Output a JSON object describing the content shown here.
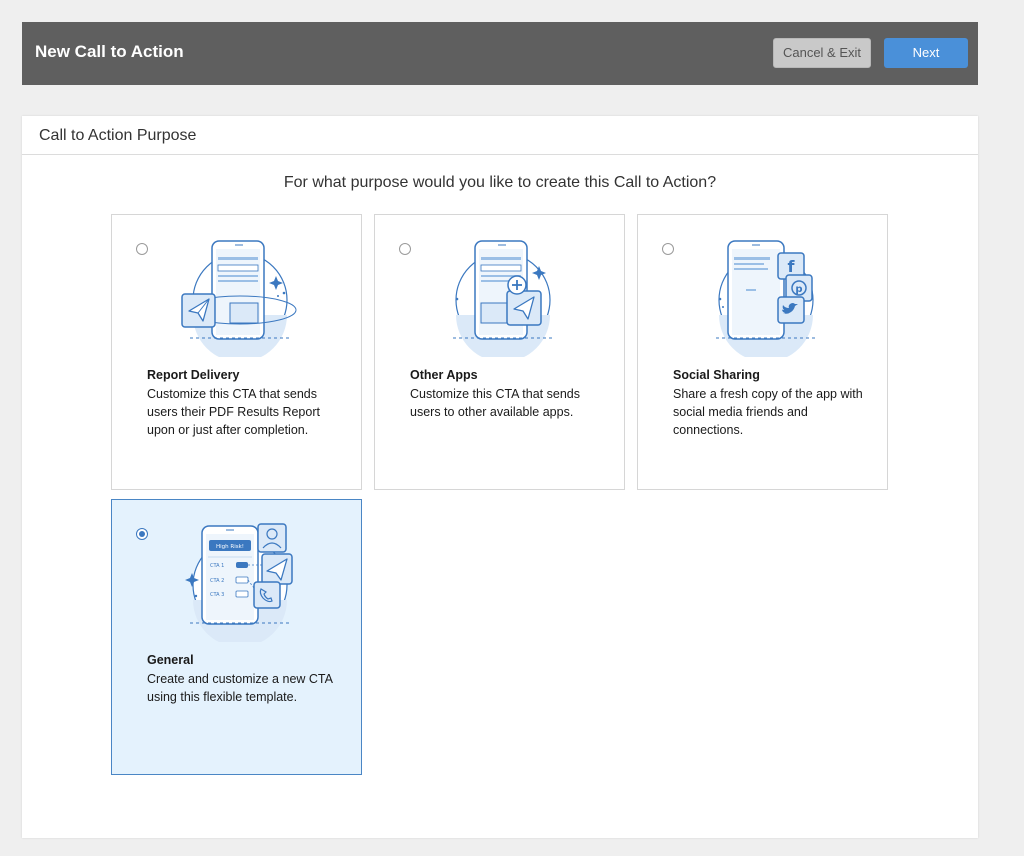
{
  "header": {
    "title": "New Call to Action",
    "cancel_label": "Cancel & Exit",
    "next_label": "Next"
  },
  "panel": {
    "title": "Call to Action Purpose",
    "question": "For what purpose would you like to create this Call to Action?"
  },
  "options": [
    {
      "name": "Report Delivery",
      "description": "Customize this CTA that sends users their PDF Results Report upon or just after completion.",
      "selected": false,
      "icon": "paper-plane-phone-illustration"
    },
    {
      "name": "Other Apps",
      "description": "Customize this CTA that sends users to other available apps.",
      "selected": false,
      "icon": "phone-plus-send-illustration"
    },
    {
      "name": "Social Sharing",
      "description": "Share a fresh copy of the app with social media friends and connections.",
      "selected": false,
      "icon": "phone-social-icons-illustration"
    },
    {
      "name": "General",
      "description": "Create and customize a new CTA using this flexible template.",
      "selected": true,
      "icon": "phone-cta-list-illustration",
      "illustration_labels": {
        "badge": "High Risk!",
        "cta1": "CTA 1",
        "cta2": "CTA 2",
        "cta3": "CTA 3"
      }
    }
  ],
  "colors": {
    "header_bg": "#5f5f5f",
    "accent": "#4a90d9",
    "selected_bg": "#e4f2fd",
    "illustration_blue": "#3b78c0",
    "illustration_fill": "#dbe9f8"
  }
}
